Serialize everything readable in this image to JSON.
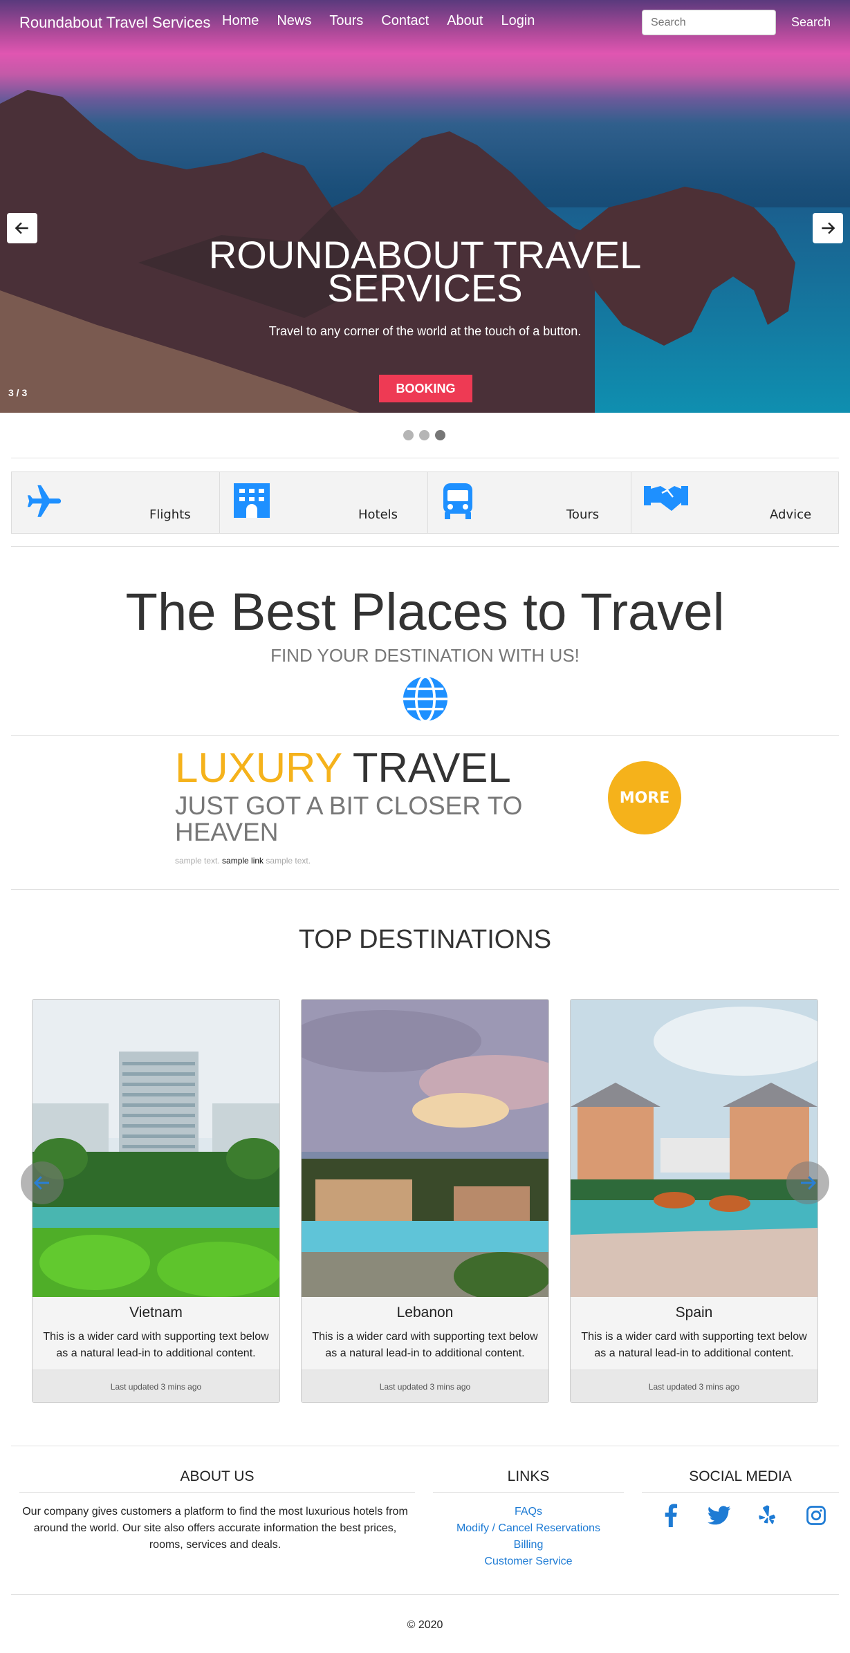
{
  "nav": {
    "brand": "Roundabout Travel Services",
    "links": [
      "Home",
      "News",
      "Tours",
      "Contact",
      "About",
      "Login"
    ],
    "search_placeholder": "Search",
    "search_button": "Search"
  },
  "hero": {
    "title_line1": "ROUNDABOUT TRAVEL",
    "title_line2": "SERVICES",
    "subtitle": "Travel to any corner of the world at the touch of a button.",
    "booking_label": "BOOKING",
    "counter": "3 / 3",
    "active_slide": 3,
    "slide_count": 3
  },
  "services": [
    {
      "label": "Flights",
      "icon": "plane-icon"
    },
    {
      "label": "Hotels",
      "icon": "hotel-icon"
    },
    {
      "label": "Tours",
      "icon": "bus-icon"
    },
    {
      "label": "Advice",
      "icon": "handshake-icon"
    }
  ],
  "best": {
    "title": "The Best Places to Travel",
    "subtitle": "FIND YOUR DESTINATION WITH US!"
  },
  "luxury": {
    "accent_word": "LUXURY",
    "rest_word": " TRAVEL",
    "line2": "JUST GOT A BIT CLOSER TO HEAVEN",
    "small_before": "sample text. ",
    "small_link": "sample link",
    "small_after": " sample text.",
    "more_label": "MORE"
  },
  "top_destinations": {
    "title": "TOP DESTINATIONS",
    "cards": [
      {
        "title": "Vietnam",
        "text": "This is a wider card with supporting text below as a natural lead-in to additional content.",
        "footer": "Last updated 3 mins ago"
      },
      {
        "title": "Lebanon",
        "text": "This is a wider card with supporting text below as a natural lead-in to additional content.",
        "footer": "Last updated 3 mins ago"
      },
      {
        "title": "Spain",
        "text": "This is a wider card with supporting text below as a natural lead-in to additional content.",
        "footer": "Last updated 3 mins ago"
      }
    ]
  },
  "footer": {
    "about_title": "ABOUT US",
    "about_text": "Our company gives customers a platform to find the most luxurious hotels from around the world. Our site also offers accurate information the best prices, rooms, services and deals.",
    "links_title": "LINKS",
    "links": [
      "FAQs",
      "Modify / Cancel Reservations",
      "Billing",
      "Customer Service"
    ],
    "social_title": "SOCIAL MEDIA",
    "social": [
      "facebook-icon",
      "twitter-icon",
      "yelp-icon",
      "instagram-icon"
    ],
    "copyright": "© 2020"
  },
  "colors": {
    "accent_blue": "#1e90ff",
    "booking_red": "#ee3a54",
    "luxury_gold": "#f5b21b",
    "link_blue": "#1e7bd4"
  }
}
